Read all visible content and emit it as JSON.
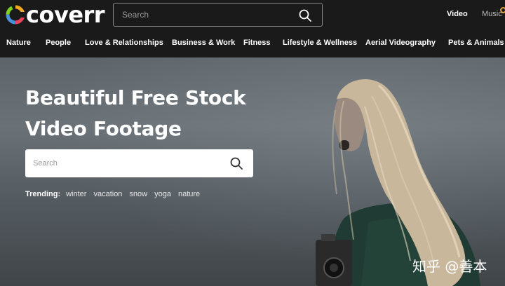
{
  "header": {
    "logo_text": "coverr",
    "search": {
      "placeholder": "Search"
    },
    "nav": {
      "video": "Video",
      "music": "Music"
    }
  },
  "categories": [
    "Nature",
    "People",
    "Love & Relationships",
    "Business & Work",
    "Fitness",
    "Lifestyle & Wellness",
    "Aerial Videography",
    "Pets & Animals"
  ],
  "hero": {
    "title_line1": "Beautiful Free Stock",
    "title_line2": "Video Footage",
    "search": {
      "placeholder": "Search"
    },
    "trending_label": "Trending:",
    "trending": [
      "winter",
      "vacation",
      "snow",
      "yoga",
      "nature"
    ]
  },
  "watermark": "知乎 @善本",
  "colors": {
    "background": "#1a1a1a",
    "text": "#ffffff",
    "logo_ring": [
      "#f5a623",
      "#e9445a",
      "#4a90e2",
      "#7ed321"
    ]
  }
}
